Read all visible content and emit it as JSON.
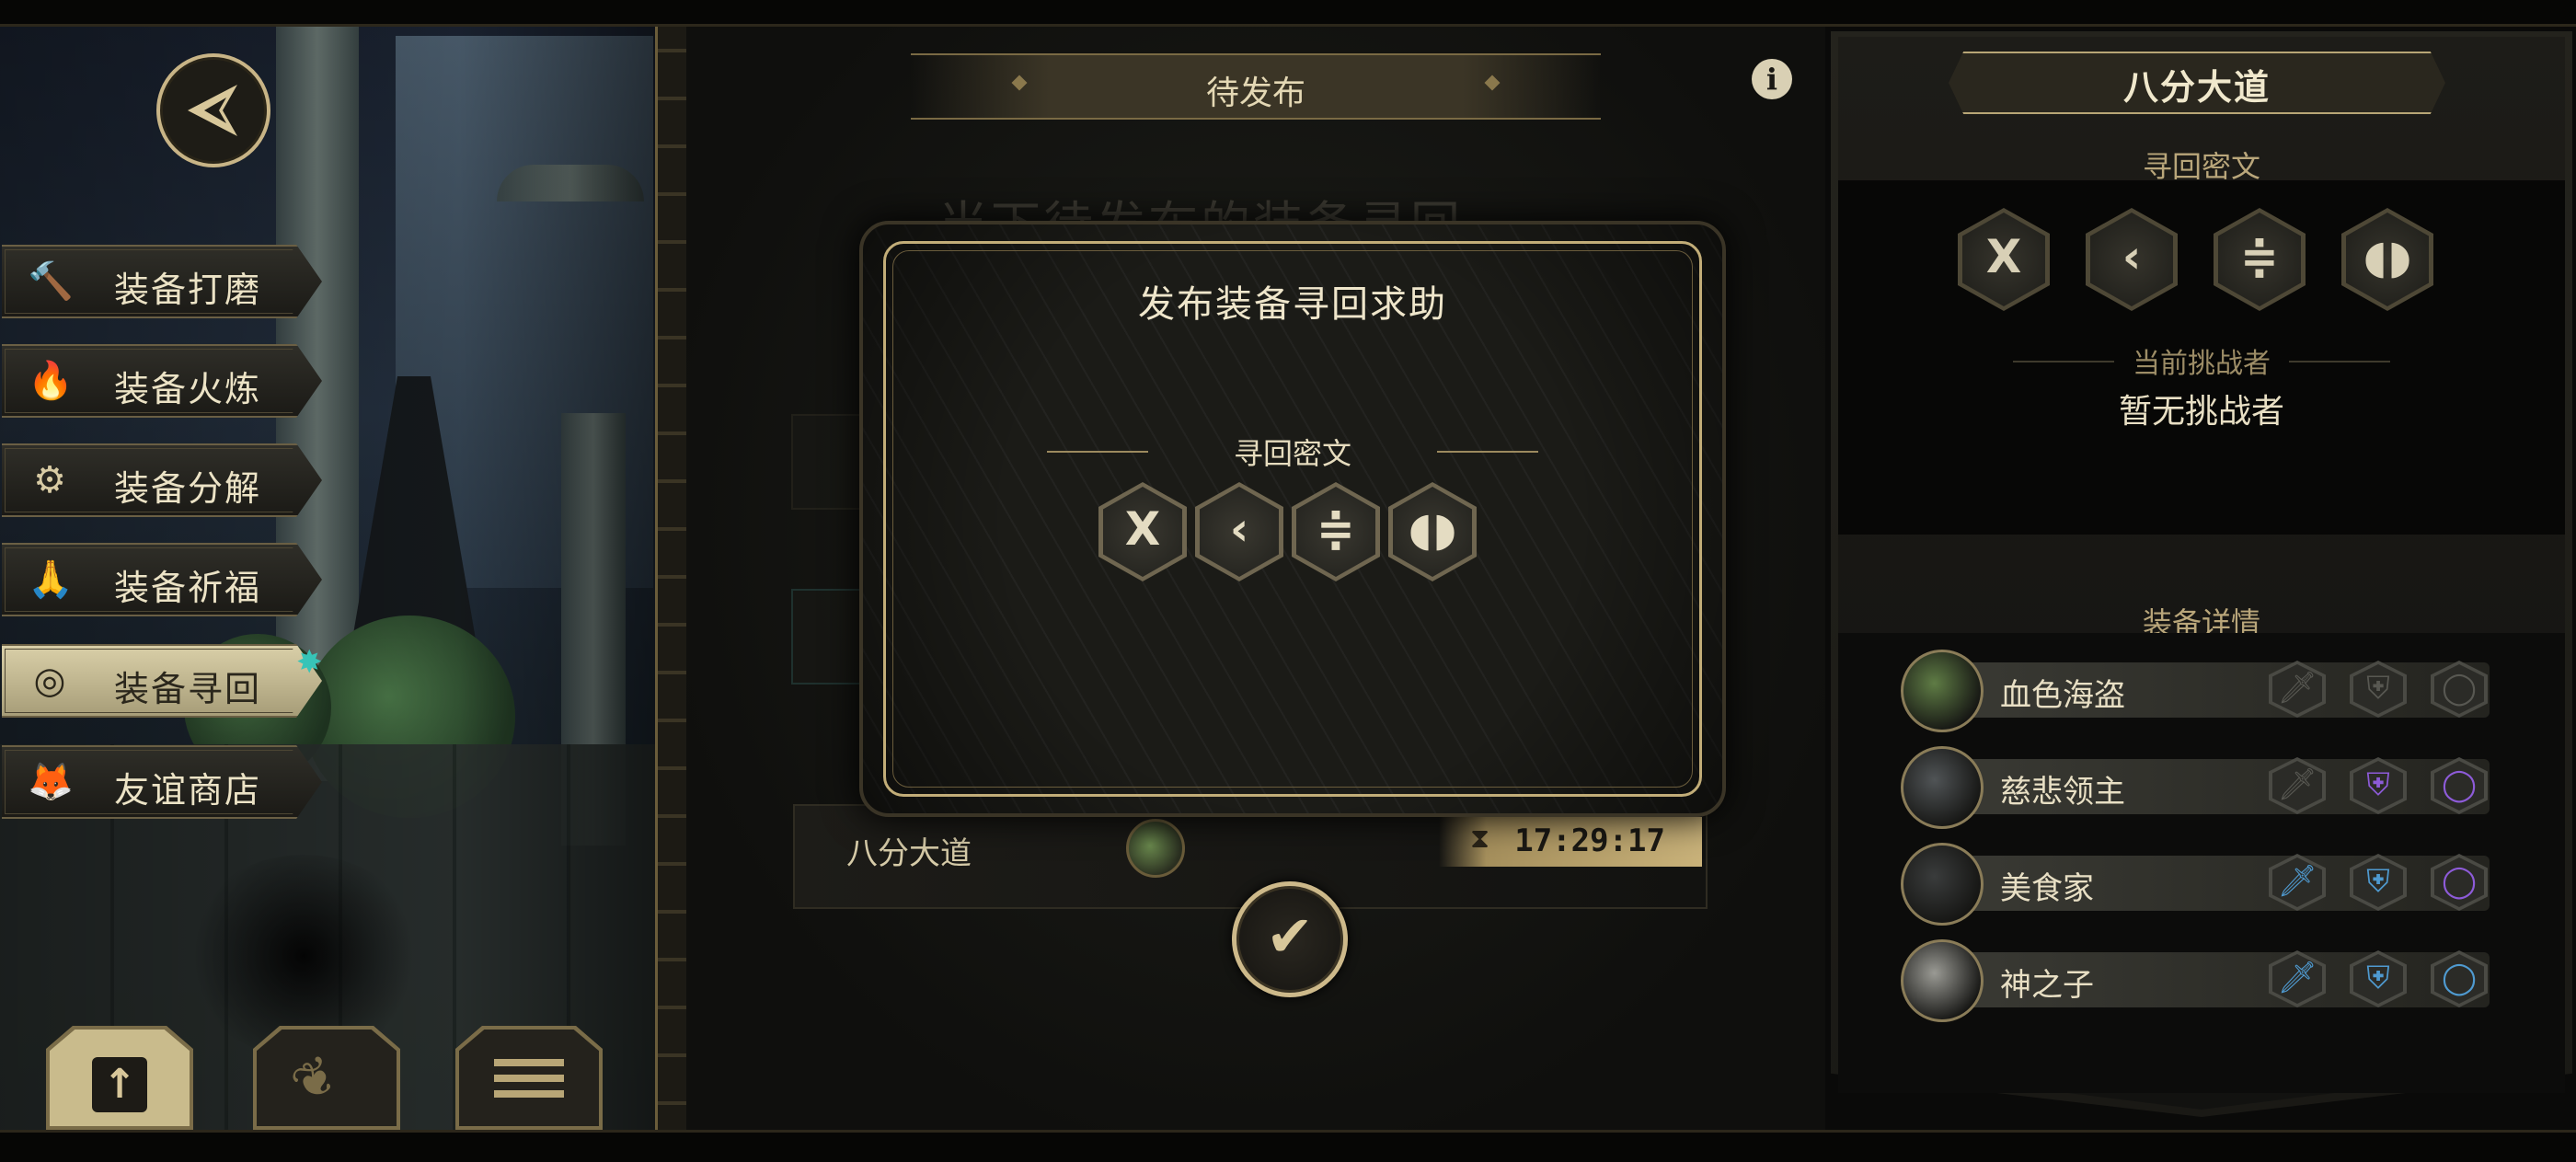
{
  "menu": {
    "items": [
      {
        "label": "装备打磨",
        "icon": "hammer-icon",
        "glyph": "🔨",
        "active": false
      },
      {
        "label": "装备火炼",
        "icon": "flame-icon",
        "glyph": "🔥",
        "active": false
      },
      {
        "label": "装备分解",
        "icon": "disassemble-icon",
        "glyph": "⚙",
        "active": false
      },
      {
        "label": "装备祈福",
        "icon": "pray-hands-icon",
        "glyph": "🙏",
        "active": false
      },
      {
        "label": "装备寻回",
        "icon": "target-icon",
        "glyph": "◎",
        "active": true
      },
      {
        "label": "友谊商店",
        "icon": "fox-icon",
        "glyph": "🦊",
        "active": false
      }
    ]
  },
  "center": {
    "tab_title": "待发布",
    "bg_title": "当下待发布的装备寻回",
    "list_row": {
      "name": "八分大道",
      "timer": "17:29:17"
    }
  },
  "dialog": {
    "title": "发布装备寻回求助",
    "subtitle": "寻回密文",
    "runes": [
      "X",
      "‹",
      "≑",
      "◖◗"
    ]
  },
  "right_panel": {
    "title": "八分大道",
    "section_cipher": "寻回密文",
    "runes": [
      "X",
      "‹",
      "≑",
      "◖◗"
    ],
    "challenger_label": "当前挑战者",
    "challenger_value": "暂无挑战者",
    "section_equipment": "装备详情",
    "equipment": [
      {
        "name": "血色海盗",
        "avatar_color": "#5f7c45",
        "slots": [
          "gray",
          "gray",
          "gray"
        ]
      },
      {
        "name": "慈悲领主",
        "avatar_color": "#505456",
        "slots": [
          "gray",
          "purple",
          "purple"
        ]
      },
      {
        "name": "美食家",
        "avatar_color": "#3a3c3c",
        "slots": [
          "blue",
          "blue",
          "purple"
        ]
      },
      {
        "name": "神之子",
        "avatar_color": "#9a9a94",
        "slots": [
          "blue",
          "blue",
          "blue"
        ]
      }
    ]
  },
  "colors": {
    "gold_accent": "#c8b486",
    "rarity_blue": "#4f9ad0",
    "rarity_purple": "#8d5bd8",
    "teal_sparkle": "#37c4b8"
  }
}
